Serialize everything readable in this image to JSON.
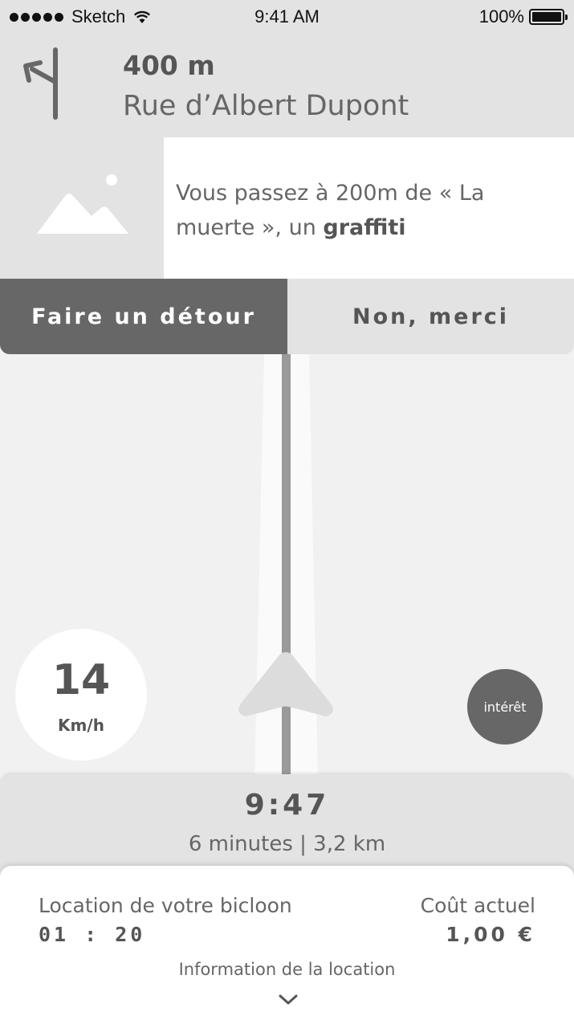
{
  "status_bar": {
    "carrier": "Sketch",
    "time": "9:41 AM",
    "battery": "100%",
    "signal_icon": "signal-dots-icon",
    "wifi_icon": "wifi-icon",
    "battery_icon": "battery-icon",
    "battery_level": 1.0
  },
  "navigation": {
    "turn_icon": "turn-left-icon",
    "distance": "400 m",
    "street": "Rue d’Albert Dupont"
  },
  "poi": {
    "image_icon": "image-placeholder-icon",
    "message_prefix": "Vous passez à 200m de « La muerte », un ",
    "message_highlight": "graffiti"
  },
  "actions": {
    "detour_label": "Faire un détour",
    "decline_label": "Non, merci"
  },
  "map": {
    "arrow_icon": "navigation-arrow-icon"
  },
  "speed": {
    "value": "14",
    "unit": "Km/h"
  },
  "interest_button": {
    "label": "intérêt"
  },
  "eta": {
    "time": "9:47",
    "info": "6 minutes | 3,2 km"
  },
  "rental": {
    "label": "Location de votre bicloon",
    "duration": "01 : 20",
    "cost_label": "Coût actuel",
    "cost_value": "1,00 €",
    "info_link": "Information de la location",
    "chevron_icon": "chevron-down-icon"
  },
  "colors": {
    "dark_gray": "#676767",
    "light_gray": "#e3e3e3",
    "map_background": "#f1f1f1",
    "text_gray": "#555555"
  }
}
